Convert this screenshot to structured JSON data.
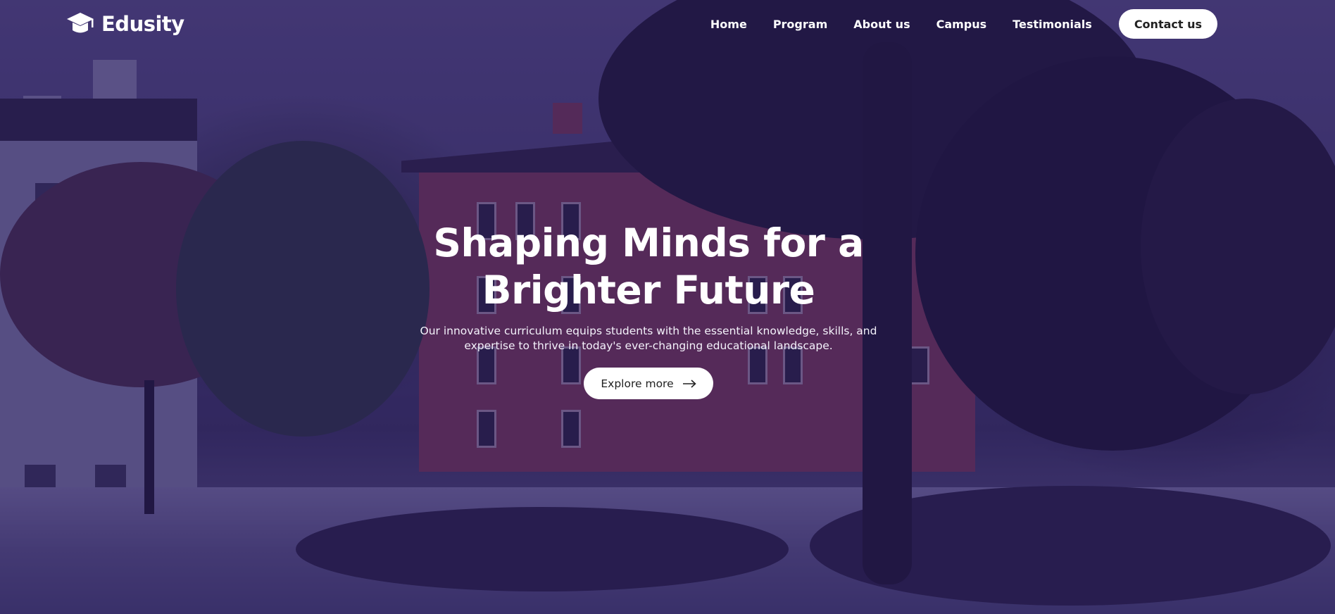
{
  "brand": {
    "name": "Edusity",
    "logo_icon": "graduation-cap-icon"
  },
  "nav": {
    "links": [
      "Home",
      "Program",
      "About us",
      "Campus",
      "Testimonials"
    ],
    "contact_label": "Contact us"
  },
  "hero": {
    "title": "Shaping Minds for a Brighter Future",
    "subtitle": "Our innovative curriculum equips students with the essential knowledge, skills, and expertise to thrive in today's ever-changing educational landscape.",
    "cta_label": "Explore more",
    "cta_icon": "arrow-right-icon",
    "background": "campus-photo"
  },
  "colors": {
    "overlay": "#26185c",
    "button_bg": "#ffffff",
    "button_text": "#212121",
    "text": "#ffffff"
  }
}
